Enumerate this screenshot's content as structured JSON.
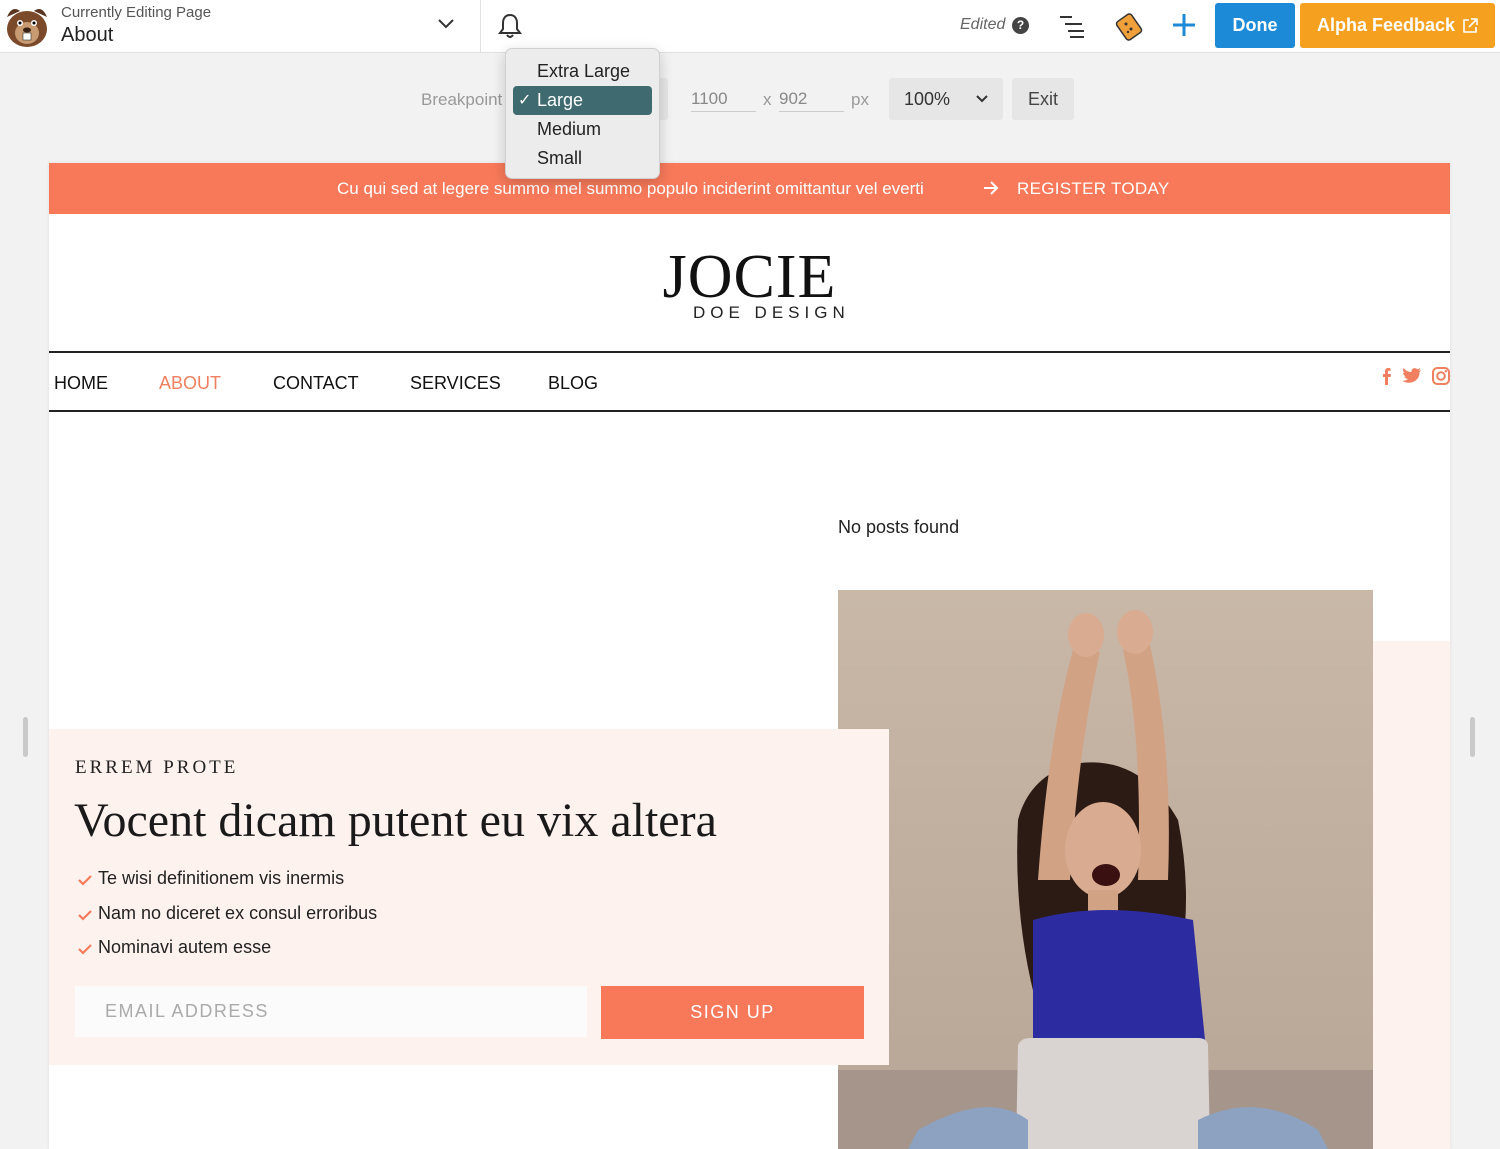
{
  "topbar": {
    "editing_label": "Currently Editing Page",
    "page_name": "About",
    "status": "Edited",
    "help_glyph": "?",
    "done_label": "Done",
    "feedback_label": "Alpha Feedback",
    "icons": [
      "beaver-logo-icon",
      "chevron-down-icon",
      "bell-icon",
      "help-icon",
      "outline-icon",
      "cookie-icon",
      "plus-icon",
      "external-link-icon"
    ]
  },
  "responsive": {
    "breakpoint_label": "Breakpoint",
    "width": "1100",
    "x_sep": "x",
    "height": "902",
    "unit": "px",
    "zoom": "100%",
    "exit_label": "Exit",
    "breakpoint_options": [
      "Extra Large",
      "Large",
      "Medium",
      "Small"
    ],
    "selected_breakpoint": "Large",
    "check_glyph": "✓"
  },
  "site": {
    "announcement": "Cu qui sed at legere summo mel summo populo inciderint omittantur vel everti",
    "announcement_cta": "REGISTER TODAY",
    "brand_name": "JOCIE",
    "brand_sub": "DOE DESIGN",
    "nav": [
      "HOME",
      "ABOUT",
      "CONTACT",
      "SERVICES",
      "BLOG"
    ],
    "active_nav": "ABOUT",
    "social_icons": [
      "facebook-icon",
      "twitter-icon",
      "instagram-icon"
    ],
    "no_posts": "No posts found",
    "promo": {
      "eyebrow": "ERREM PROTE",
      "heading": "Vocent dicam putent eu vix altera",
      "items": [
        "Te wisi definitionem vis inermis",
        "Nam no diceret ex consul erroribus",
        "Nominavi autem esse"
      ],
      "email_placeholder": "EMAIL ADDRESS",
      "signup_label": "SIGN UP"
    }
  },
  "colors": {
    "accent": "#f7795a",
    "done_blue": "#1c8ad6",
    "feedback_orange": "#f6a01f",
    "selected_option": "#3f6b70",
    "promo_bg": "#fdf2ee"
  }
}
